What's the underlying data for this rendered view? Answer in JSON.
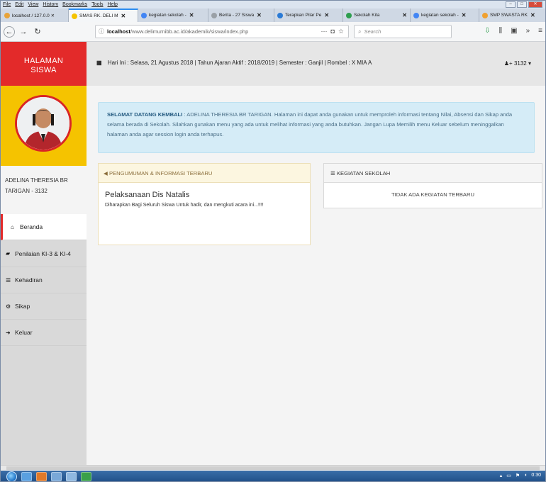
{
  "browser": {
    "menu": [
      "File",
      "Edit",
      "View",
      "History",
      "Bookmarks",
      "Tools",
      "Help"
    ],
    "tabs": [
      {
        "label": "localhost / 127.0.0 ✕",
        "active": false,
        "color": "#e8a33a"
      },
      {
        "label": "SMAS RK. DELI M",
        "active": true,
        "color": "#f5c300"
      },
      {
        "label": "kegiatan sekolah -",
        "active": false,
        "color": "#4285f4"
      },
      {
        "label": "Berita - 27 Siswa",
        "active": false,
        "color": "#9aa0a6"
      },
      {
        "label": "Terapkan Pilar Pe",
        "active": false,
        "color": "#2a7ad5"
      },
      {
        "label": "Sekolah Kita",
        "active": false,
        "color": "#2e9e4e"
      },
      {
        "label": "kegiatan sekolah -",
        "active": false,
        "color": "#4285f4"
      },
      {
        "label": "SMP SWASTA RK",
        "active": false,
        "color": "#f0a030"
      }
    ],
    "url_host": "localhost",
    "url_path": "/www.delimurnibb.ac.id/akademik/siswa/index.php",
    "search_placeholder": "Search"
  },
  "sidebar": {
    "brand_line1": "HALAMAN",
    "brand_line2": "SISWA",
    "student_name": "ADELINA THERESIA BR TARIGAN - 3132",
    "items": [
      {
        "label": "Beranda",
        "icon": "home-icon",
        "glyph": "⌂",
        "active": true
      },
      {
        "label": "Penilaian KI-3 & KI-4",
        "icon": "book-icon",
        "glyph": "▰",
        "active": false
      },
      {
        "label": "Kehadiran",
        "icon": "list-icon",
        "glyph": "☰",
        "active": false
      },
      {
        "label": "Sikap",
        "icon": "gears-icon",
        "glyph": "⚙",
        "active": false
      },
      {
        "label": "Keluar",
        "icon": "sign-out-icon",
        "glyph": "➜",
        "active": false
      }
    ]
  },
  "topbar": {
    "info": "Hari Ini : Selasa, 21 Agustus 2018 | Tahun Ajaran Aktif : 2018/2019 | Semester : Ganjil | Rombel : X MIA A",
    "user": "3132 ▾"
  },
  "welcome": {
    "heading": "SELAMAT DATANG KEMBALI",
    "text": " : ADELINA THERESIA BR TARIGAN. Halaman ini dapat anda gunakan untuk memproleh informasi tentang Nilai, Absensi dan Sikap anda selama berada di Sekolah. Silahkan gunakan menu yang ada untuk melihat informasi yang anda butuhkan. Jangan Lupa Memilih menu Keluar sebelum meninggalkan halaman anda agar session login anda terhapus."
  },
  "announcement": {
    "header": "PENGUMUMAN & INFORMASI TERBARU",
    "title": "Pelaksanaan Dis Natalis",
    "body": "Diharapkan Bagi Seluruh Siswa Untuk hadir, dan mengkuti acara ini...!!!!"
  },
  "kegiatan": {
    "header": "KEGIATAN SEKOLAH",
    "empty": "TIDAK ADA KEGIATAN TERBARU"
  },
  "taskbar": {
    "clock": "0:30"
  }
}
